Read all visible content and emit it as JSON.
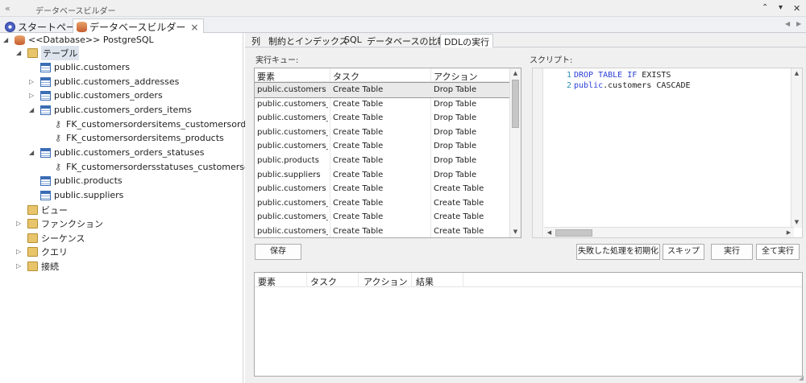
{
  "window": {
    "title": "データベースビルダー"
  },
  "doc_tabs": [
    {
      "label": "スタートページ"
    },
    {
      "label": "データベースビルダー",
      "close": "×"
    }
  ],
  "tree": {
    "root": "<<Database>> PostgreSQL",
    "tables_folder": "テーブル",
    "tables": [
      "public.customers",
      "public.customers_addresses",
      "public.customers_orders",
      "public.customers_orders_items",
      "FK_customersordersitems_customersorders",
      "FK_customersordersitems_products",
      "public.customers_orders_statuses",
      "FK_customersordersstatuses_customersorders",
      "public.products",
      "public.suppliers"
    ],
    "folders": [
      "ビュー",
      "ファンクション",
      "シーケンス",
      "クエリ",
      "接続"
    ]
  },
  "sub_tabs": [
    "列",
    "制約とインデックス",
    "SQL",
    "データベースの比較",
    "DDLの実行"
  ],
  "queue": {
    "label": "実行キュー:",
    "columns": [
      "要素",
      "タスク",
      "アクション"
    ],
    "rows": [
      [
        "public.customers",
        "Create Table",
        "Drop Table"
      ],
      [
        "public.customers_...",
        "Create Table",
        "Drop Table"
      ],
      [
        "public.customers_...",
        "Create Table",
        "Drop Table"
      ],
      [
        "public.customers_...",
        "Create Table",
        "Drop Table"
      ],
      [
        "public.customers_...",
        "Create Table",
        "Drop Table"
      ],
      [
        "public.products",
        "Create Table",
        "Drop Table"
      ],
      [
        "public.suppliers",
        "Create Table",
        "Drop Table"
      ],
      [
        "public.customers",
        "Create Table",
        "Create Table"
      ],
      [
        "public.customers_...",
        "Create Table",
        "Create Table"
      ],
      [
        "public.customers_...",
        "Create Table",
        "Create Table"
      ],
      [
        "public.customers_...",
        "Create Table",
        "Create Table"
      ]
    ]
  },
  "script": {
    "label": "スクリプト:",
    "lines": [
      {
        "num": "1",
        "kw1": "DROP TABLE IF",
        "rest": " EXISTS"
      },
      {
        "num": "2",
        "kw1": "public",
        "rest": ".customers CASCADE"
      }
    ]
  },
  "buttons": {
    "save": "保存",
    "reset_failed": "失敗した処理を初期化",
    "skip": "スキップ",
    "execute": "実行",
    "execute_all": "全て実行"
  },
  "results": {
    "columns": [
      "要素",
      "タスク",
      "アクション",
      "結果"
    ]
  }
}
